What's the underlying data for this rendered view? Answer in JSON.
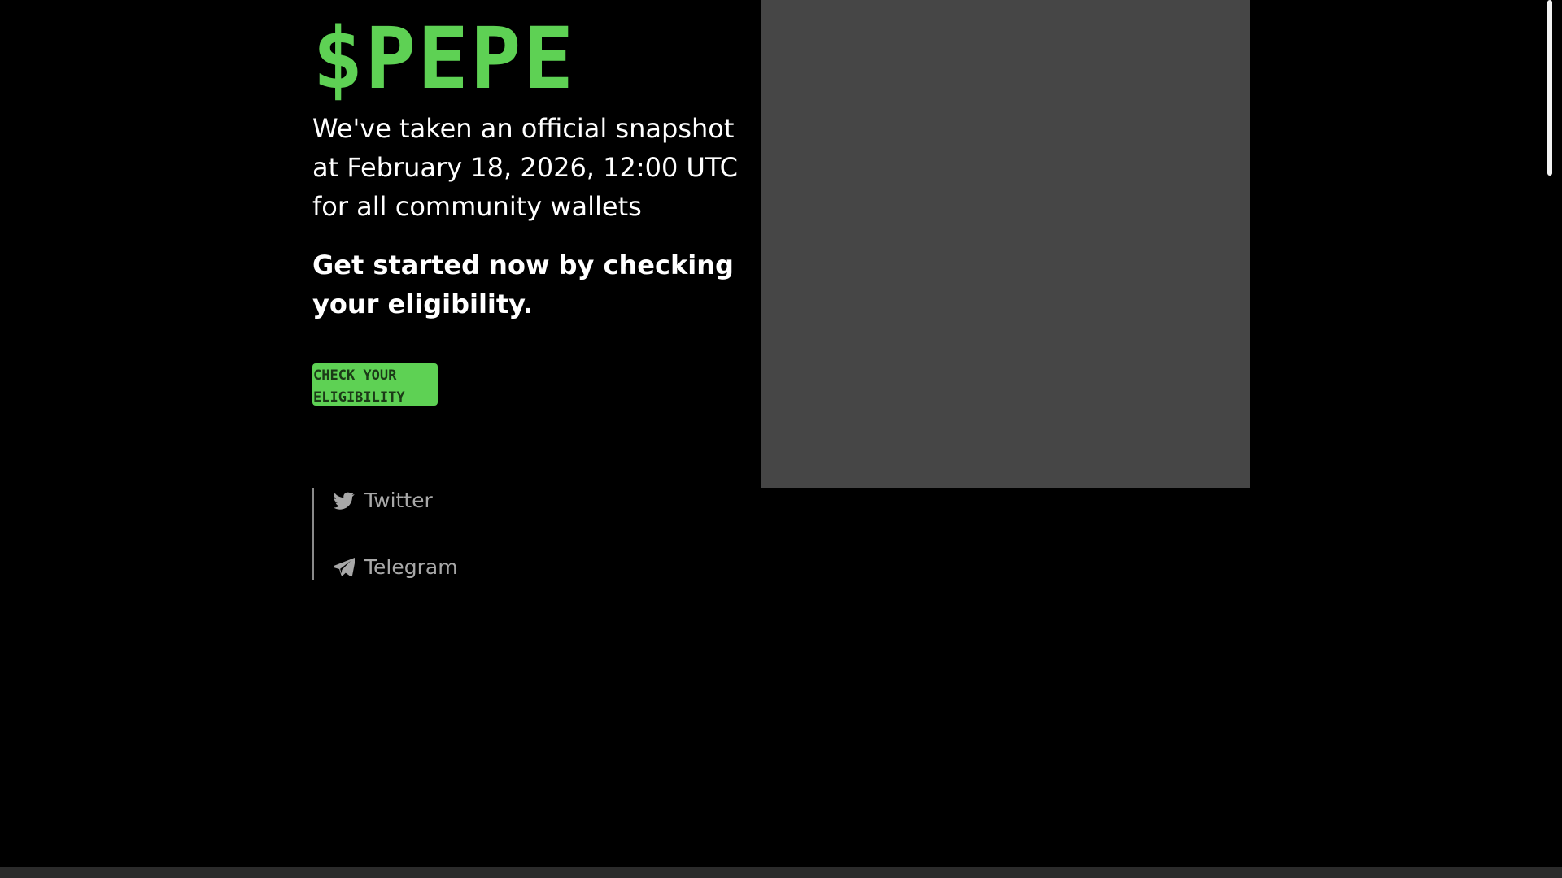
{
  "brand": {
    "logo_text": "$PEPE",
    "accent_color": "#5ed154"
  },
  "hero": {
    "intro": "We've taken an official snapshot at February 18, 2026, 12:00 UTC for all community wallets",
    "cta_text": "Get started now by checking your eligibility.",
    "check_button": {
      "line1": "CHECK YOUR",
      "line2": "ELIGIBILITY"
    },
    "image_placeholder_color": "#464646"
  },
  "social": {
    "items": [
      {
        "label": "Twitter",
        "icon": "twitter-bird-icon"
      },
      {
        "label": "Telegram",
        "icon": "telegram-paper-plane-icon"
      }
    ]
  }
}
